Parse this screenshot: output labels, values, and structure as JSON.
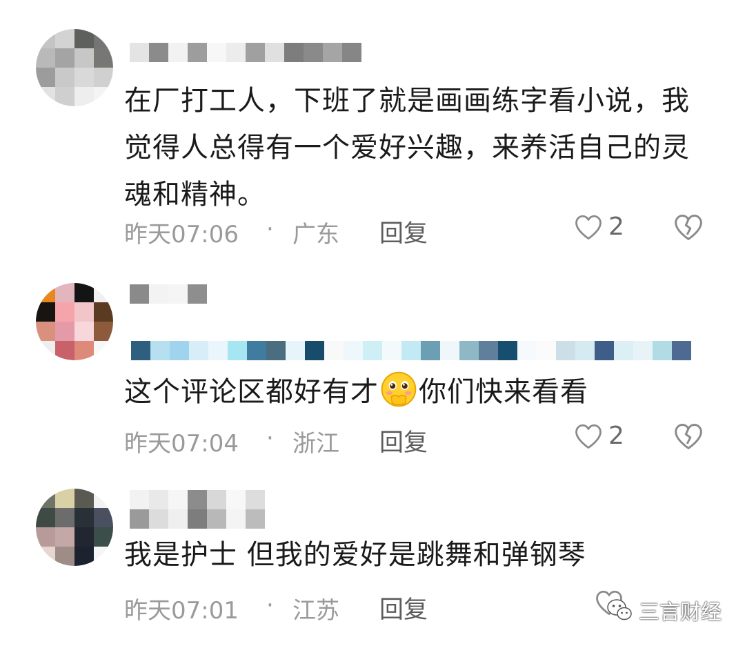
{
  "comments": [
    {
      "text": "在厂打工人，下班了就是画画练字看小说，我觉得人总得有一个爱好兴趣，来养活自己的灵魂和精神。",
      "time": "昨天07:06",
      "separator": "·",
      "location": "广东",
      "reply_label": "回复",
      "like_count": "2"
    },
    {
      "text_before": "这个评论区都好有才",
      "text_after": "你们快来看看",
      "emoji": "blushing-face-emoji",
      "time": "昨天07:04",
      "separator": "·",
      "location": "浙江",
      "reply_label": "回复",
      "like_count": "2"
    },
    {
      "text": "我是护士 但我的爱好是跳舞和弹钢琴",
      "time": "昨天07:01",
      "separator": "·",
      "location": "江苏",
      "reply_label": "回复"
    }
  ],
  "icons": {
    "like": "heart-outline-icon",
    "dislike": "broken-heart-icon",
    "watermark_logo": "wechat-icon"
  },
  "watermark": {
    "text": "三言财经"
  },
  "colors": {
    "text": "#1a1a1a",
    "meta": "#9a9a9a",
    "reply": "#5c5c5c",
    "icon": "#8a8a8a"
  }
}
